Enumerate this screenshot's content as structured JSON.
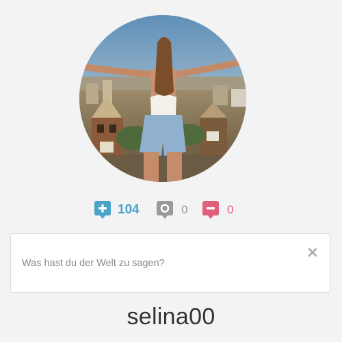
{
  "profile": {
    "username": "selina00",
    "avatar_icon": "profile-photo"
  },
  "stats": {
    "positive": {
      "count": "104",
      "icon": "plus-bubble-icon",
      "color": "#4aa3c8"
    },
    "neutral": {
      "count": "0",
      "icon": "circle-bubble-icon",
      "color": "#9a9a9a"
    },
    "negative": {
      "count": "0",
      "icon": "minus-bubble-icon",
      "color": "#e0607a"
    }
  },
  "compose": {
    "placeholder": "Was hast du der Welt zu sagen?",
    "value": "",
    "clear_label": "×"
  }
}
